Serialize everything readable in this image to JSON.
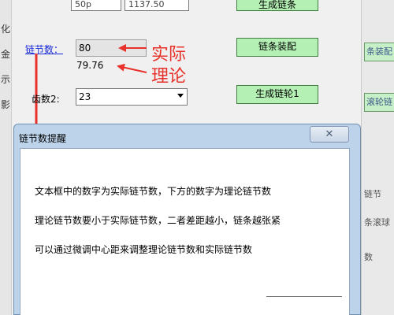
{
  "background_window": {
    "top_field_1": "50p",
    "top_field_2": "1137.50",
    "generate_chain_button": "生成链条",
    "chain_count_label": "链节数：",
    "actual_chain_count": "80",
    "theoretical_chain_count": "79.76",
    "assemble_chain_button": "链条装配",
    "annotation_actual": "实际",
    "annotation_theory": "理论",
    "teeth2_label": "齿数2:",
    "teeth2_value": "23",
    "generate_sprocket1_button": "生成链轮1",
    "left_fragments": [
      "化",
      "金",
      "示",
      "影"
    ],
    "right_fragments": [
      "条装配",
      "滚轮链",
      "链节",
      "条滚球",
      "数"
    ]
  },
  "dialog": {
    "title": "链节数提醒",
    "lines": [
      "文本框中的数字为实际链节数，下方的数字为理论链节数",
      "理论链节数要小于实际链节数，二者差距越小，链条越张紧",
      "可以通过微调中心距来调整理论链节数和实际链节数"
    ]
  },
  "icons": {
    "close": "close-icon",
    "dropdown": "chevron-down-icon",
    "arrow": "red-arrow-annotation"
  },
  "colors": {
    "accent_green": "#b4f0b4",
    "link_blue": "#1a2ad8",
    "annotation_red": "#e8312a",
    "dialog_frame": "#bcd3ea"
  }
}
